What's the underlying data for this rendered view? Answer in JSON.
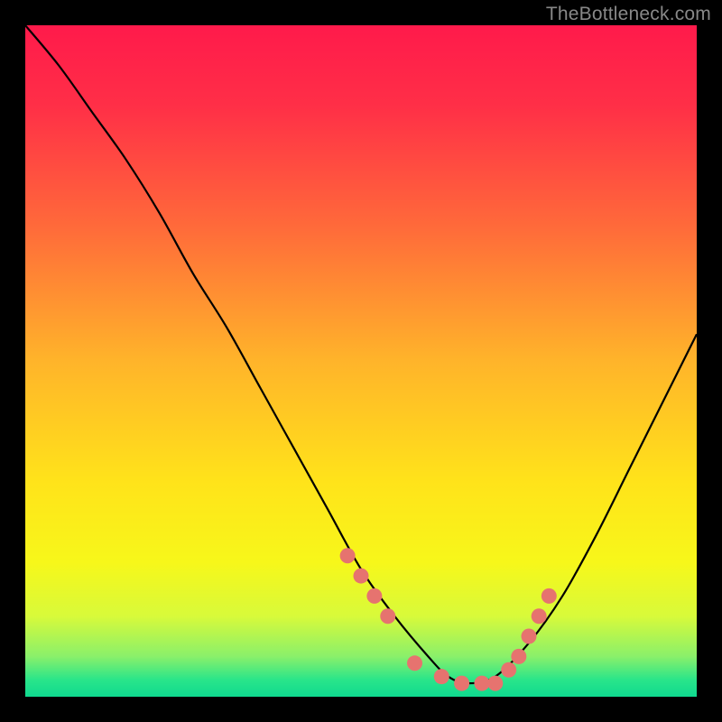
{
  "watermark": "TheBottleneck.com",
  "chart_data": {
    "type": "line",
    "title": "",
    "xlabel": "",
    "ylabel": "",
    "xlim": [
      0,
      100
    ],
    "ylim": [
      0,
      100
    ],
    "series": [
      {
        "name": "bottleneck-curve",
        "x": [
          0,
          5,
          10,
          15,
          20,
          25,
          30,
          35,
          40,
          45,
          50,
          55,
          60,
          63,
          66,
          70,
          75,
          80,
          85,
          90,
          95,
          100
        ],
        "y": [
          100,
          94,
          87,
          80,
          72,
          63,
          55,
          46,
          37,
          28,
          19,
          12,
          6,
          3,
          2,
          3,
          8,
          15,
          24,
          34,
          44,
          54
        ]
      }
    ],
    "markers": {
      "name": "highlight-dots",
      "color": "#e6736f",
      "x": [
        48,
        50,
        52,
        54,
        58,
        62,
        65,
        68,
        70,
        72,
        73.5,
        75,
        76.5,
        78
      ],
      "y": [
        21,
        18,
        15,
        12,
        5,
        3,
        2,
        2,
        2,
        4,
        6,
        9,
        12,
        15
      ]
    },
    "background_gradient": {
      "stops": [
        {
          "pos": 0.0,
          "color": "#ff1a4b"
        },
        {
          "pos": 0.12,
          "color": "#ff2f47"
        },
        {
          "pos": 0.3,
          "color": "#ff6a3a"
        },
        {
          "pos": 0.5,
          "color": "#ffb42a"
        },
        {
          "pos": 0.68,
          "color": "#ffe31a"
        },
        {
          "pos": 0.8,
          "color": "#f7f71a"
        },
        {
          "pos": 0.88,
          "color": "#d8fa3a"
        },
        {
          "pos": 0.94,
          "color": "#8af06a"
        },
        {
          "pos": 0.975,
          "color": "#29e58a"
        },
        {
          "pos": 1.0,
          "color": "#0fd98f"
        }
      ]
    }
  }
}
